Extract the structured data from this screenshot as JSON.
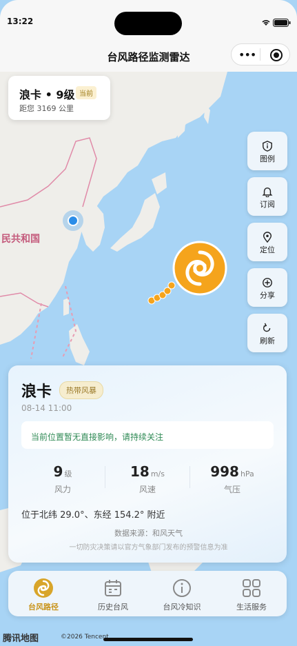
{
  "status": {
    "time": "13:22"
  },
  "header": {
    "title": "台风路径监测雷达"
  },
  "map": {
    "country_label": "民共和国",
    "typhoon_color": "#f5a41c",
    "track_color": "#f5a41c"
  },
  "info_card": {
    "title": "浪卡 • 9级",
    "badge": "当前",
    "distance": "距您 3169 公里"
  },
  "side_buttons": [
    {
      "label": "图例",
      "icon": "shield-info-icon"
    },
    {
      "label": "订阅",
      "icon": "bell-icon"
    },
    {
      "label": "定位",
      "icon": "location-pin-icon"
    },
    {
      "label": "分享",
      "icon": "plus-circle-icon"
    },
    {
      "label": "刷新",
      "icon": "refresh-icon"
    }
  ],
  "detail": {
    "name": "浪卡",
    "type": "热带风暴",
    "time": "08-14 11:00",
    "notice": "当前位置暂无直接影响，请持续关注",
    "stats": [
      {
        "value": "9",
        "unit": "级",
        "label": "风力"
      },
      {
        "value": "18",
        "unit": "m/s",
        "label": "风速"
      },
      {
        "value": "998",
        "unit": "hPa",
        "label": "气压"
      }
    ],
    "position": "位于北纬 29.0°、东经 154.2° 附近",
    "source": "数据来源：和风天气",
    "warning": "一切防灾决策请以官方气象部门发布的预警信息为准"
  },
  "tabs": [
    {
      "label": "台风路径",
      "icon": "typhoon-icon",
      "active": true
    },
    {
      "label": "历史台风",
      "icon": "calendar-icon",
      "active": false
    },
    {
      "label": "台风冷知识",
      "icon": "info-circle-icon",
      "active": false
    },
    {
      "label": "生活服务",
      "icon": "grid-icon",
      "active": false
    }
  ],
  "footer": {
    "brand": "腾讯地图",
    "copyright": "©2026 Tencent"
  },
  "colors": {
    "accent": "#c9941a",
    "sea": "#a8d4f5",
    "land": "#efeeea"
  }
}
